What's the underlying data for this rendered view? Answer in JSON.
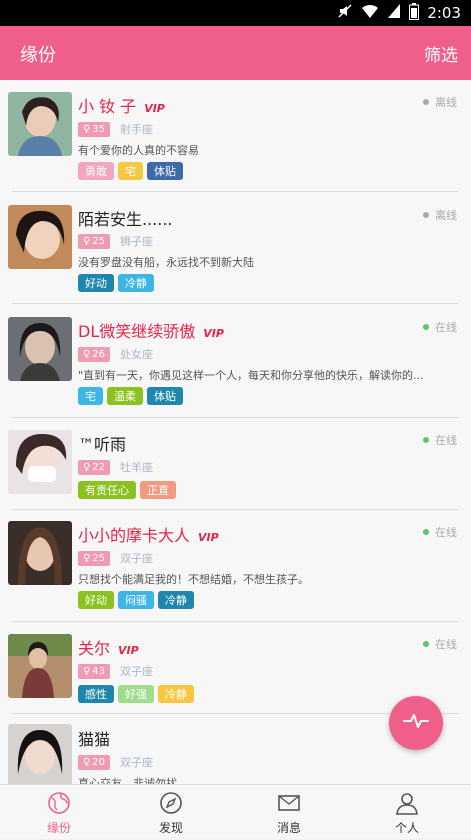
{
  "status_bar": {
    "time": "2:03"
  },
  "header": {
    "title": "缘份",
    "filter_label": "筛选"
  },
  "colors": {
    "accent": "#ef5f8a",
    "vip": "#e5244b",
    "online": "#5ac86b",
    "offline": "#aaaaaa"
  },
  "profiles": [
    {
      "name": "小 钕 子",
      "vip": true,
      "vip_label": "VIP",
      "status": "离线",
      "online": false,
      "age": "35",
      "zodiac": "射手座",
      "motto": "有个爱你的人真的不容易",
      "tags": [
        {
          "label": "勇敢",
          "color": "#f3a6c0"
        },
        {
          "label": "宅",
          "color": "#f6c842"
        },
        {
          "label": "体贴",
          "color": "#3d6aa8"
        }
      ]
    },
    {
      "name": "陌若安生......",
      "vip": false,
      "vip_label": "",
      "status": "离线",
      "online": false,
      "age": "25",
      "zodiac": "狮子座",
      "motto": "没有罗盘没有船，永远找不到新大陆",
      "tags": [
        {
          "label": "好动",
          "color": "#1f86ad"
        },
        {
          "label": "冷静",
          "color": "#3fb5e6"
        }
      ]
    },
    {
      "name": "DL微笑继续骄傲",
      "vip": true,
      "vip_label": "VIP",
      "status": "在线",
      "online": true,
      "age": "26",
      "zodiac": "处女座",
      "motto": "\"直到有一天，你遇见这样一个人，每天和你分享他的快乐，解读你的...",
      "tags": [
        {
          "label": "宅",
          "color": "#3fb5e6"
        },
        {
          "label": "温柔",
          "color": "#8cc21f"
        },
        {
          "label": "体贴",
          "color": "#1f86ad"
        }
      ]
    },
    {
      "name": "™听雨",
      "vip": false,
      "vip_label": "",
      "status": "在线",
      "online": true,
      "age": "22",
      "zodiac": "牡羊座",
      "motto": "",
      "tags": [
        {
          "label": "有责任心",
          "color": "#8cc21f"
        },
        {
          "label": "正直",
          "color": "#f09a80"
        }
      ]
    },
    {
      "name": "小小的摩卡大人",
      "vip": true,
      "vip_label": "VIP",
      "status": "在线",
      "online": true,
      "age": "25",
      "zodiac": "双子座",
      "motto": "只想找个能满足我的！不想结婚，不想生孩子。",
      "tags": [
        {
          "label": "好动",
          "color": "#8cc21f"
        },
        {
          "label": "闷骚",
          "color": "#3fb5e6"
        },
        {
          "label": "冷静",
          "color": "#1f86ad"
        }
      ]
    },
    {
      "name": "关尔",
      "vip": true,
      "vip_label": "VIP",
      "status": "在线",
      "online": true,
      "age": "43",
      "zodiac": "双子座",
      "motto": "",
      "tags": [
        {
          "label": "感性",
          "color": "#1f86ad"
        },
        {
          "label": "好强",
          "color": "#9fdc8c"
        },
        {
          "label": "冷静",
          "color": "#f6c842"
        }
      ]
    },
    {
      "name": "猫猫",
      "vip": false,
      "vip_label": "",
      "status": "",
      "online": false,
      "age": "20",
      "zodiac": "双子座",
      "motto": "真心交友，非诚勿扰",
      "tags": []
    }
  ],
  "bottom_nav": [
    {
      "label": "缘份",
      "icon": "globe-icon",
      "active": true
    },
    {
      "label": "发现",
      "icon": "compass-icon",
      "active": false
    },
    {
      "label": "消息",
      "icon": "mail-icon",
      "active": false
    },
    {
      "label": "个人",
      "icon": "person-icon",
      "active": false
    }
  ],
  "fab": {
    "icon": "pulse-icon"
  }
}
